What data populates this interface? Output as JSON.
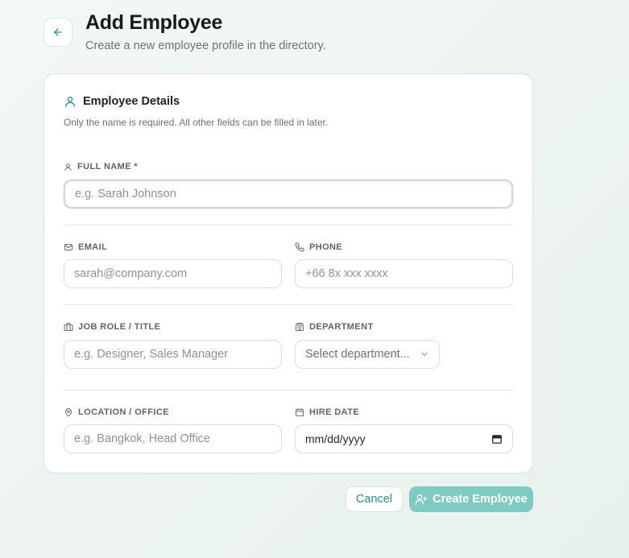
{
  "header": {
    "title": "Add Employee",
    "subtitle": "Create a new employee profile in the directory."
  },
  "section": {
    "title": "Employee Details",
    "description": "Only the name is required. All other fields can be filled in later."
  },
  "fields": {
    "full_name": {
      "label": "FULL NAME *",
      "placeholder": "e.g. Sarah Johnson",
      "value": ""
    },
    "email": {
      "label": "EMAIL",
      "placeholder": "sarah@company.com",
      "value": ""
    },
    "phone": {
      "label": "PHONE",
      "placeholder": "+66 8x xxx xxxx",
      "value": ""
    },
    "job_role": {
      "label": "JOB ROLE / TITLE",
      "placeholder": "e.g. Designer, Sales Manager",
      "value": ""
    },
    "department": {
      "label": "DEPARTMENT",
      "selected": "Select department..."
    },
    "location": {
      "label": "LOCATION / OFFICE",
      "placeholder": "e.g. Bangkok, Head Office",
      "value": ""
    },
    "hire_date": {
      "label": "HIRE DATE",
      "value": "mm/dd/yyyy"
    }
  },
  "actions": {
    "cancel_label": "Cancel",
    "create_label": "Create Employee"
  },
  "icons": {
    "back": "arrow-left-icon",
    "section": "user-icon",
    "full_name": "user-icon",
    "email": "mail-icon",
    "phone": "phone-icon",
    "job_role": "briefcase-icon",
    "department": "building-icon",
    "location": "map-pin-icon",
    "hire_date": "calendar-icon",
    "select": "chevron-down-icon",
    "create": "user-plus-icon"
  },
  "colors": {
    "accent": "#2b8f86",
    "primary_button": "#7fcbc1"
  }
}
